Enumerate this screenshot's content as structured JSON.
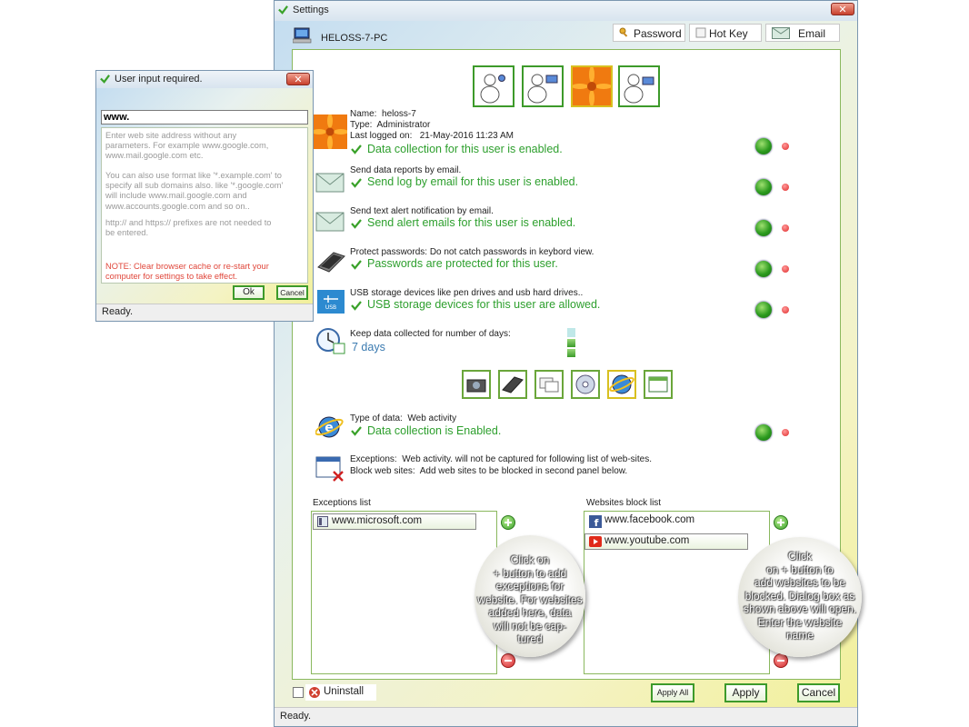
{
  "settings_window": {
    "title": "Settings",
    "computer_name": "HELOSS-7-PC",
    "header_buttons": {
      "password": "Password",
      "hot_key": "Hot Key",
      "email": "Email"
    },
    "user": {
      "name_label": "Name:",
      "name": "heloss-7",
      "type_label": "Type:",
      "type": "Administrator",
      "last_logged_label": "Last logged on:",
      "last_logged": "21-May-2016 11:23 AM",
      "status": "Data collection for this user is enabled."
    },
    "rows": [
      {
        "label": "Send data reports by email.",
        "status": "Send log by email for this user is enabled.",
        "icon": "envelope-icon"
      },
      {
        "label": "Send text alert notification by email.",
        "status": "Send alert emails for this user is enabled.",
        "icon": "envelope-icon"
      },
      {
        "label": "Protect passwords: Do not catch passwords in keybord view.",
        "status": "Passwords are protected for this user.",
        "icon": "keyboard-icon"
      },
      {
        "label": "USB storage devices like pen drives and usb hard drives..",
        "status": "USB storage devices for this user are allowed.",
        "icon": "usb-icon"
      }
    ],
    "keep_days": {
      "label": "Keep data collected for number of days:",
      "value": "7 days"
    },
    "data_type": {
      "label": "Type of data:",
      "value": "Web activity",
      "status": "Data collection is Enabled."
    },
    "exceptions_info": {
      "line1_label": "Exceptions:",
      "line1": "Web activity. will not be captured for following list of web-sites.",
      "line2_label": "Block web sites:",
      "line2": "Add web sites to be blocked in second panel below."
    },
    "exceptions_list": {
      "title": "Exceptions list",
      "items": [
        "www.microsoft.com"
      ]
    },
    "block_list": {
      "title": "Websites block list",
      "items": [
        "www.facebook.com",
        "www.youtube.com"
      ]
    },
    "bubble_left": [
      "Click on",
      "+ button to add",
      "exceptions for",
      "website. For websites",
      "added here, data",
      "will not be cap-",
      "tured"
    ],
    "bubble_right": [
      "Click",
      "on + button to",
      "add websites to be",
      "blocked. Dialog box as",
      "shown above will open.",
      "Enter the website",
      "name"
    ],
    "uninstall": "Uninstall",
    "apply_all": "Apply All",
    "apply": "Apply",
    "cancel": "Cancel",
    "status": "Ready.",
    "colors": {
      "accent_green": "#3d9a2a",
      "status_green": "#2d9f2d",
      "note_red": "#e0463a"
    }
  },
  "dialog": {
    "title": "User input required.",
    "input_value": "www.",
    "help_1": [
      "Enter web site address without any",
      "parameters. For example www.google.com,",
      "www.mail.google.com etc."
    ],
    "help_2": [
      "You can also use format like '*.example.com' to",
      "specify all sub domains also. like '*.google.com'",
      "will include www.mail.google.com and",
      "www.accounts.google.com and so on.."
    ],
    "help_3": [
      "http:// and https:// prefixes are not needed to",
      "be entered."
    ],
    "note": [
      "NOTE: Clear browser cache or re-start your",
      "computer for settings to take effect."
    ],
    "ok": "Ok",
    "cancel": "Cancel",
    "status": "Ready."
  }
}
